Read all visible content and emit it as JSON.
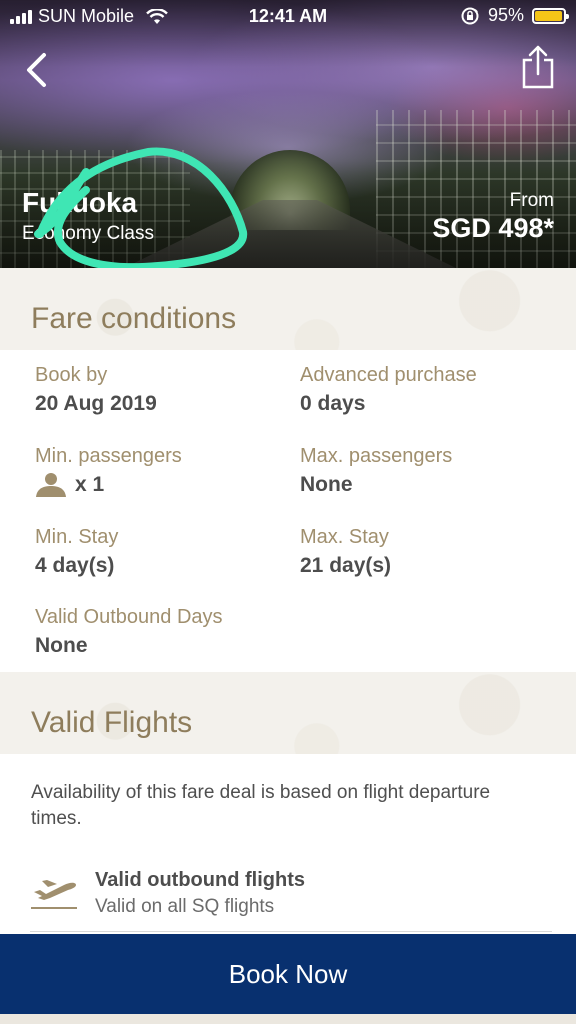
{
  "status_bar": {
    "carrier": "SUN Mobile",
    "time": "12:41 AM",
    "battery": "95%",
    "battery_level": 0.95,
    "battery_color": "#f5c518"
  },
  "header": {
    "back_icon": "chevron-left-icon",
    "share_icon": "share-icon",
    "destination": "Fukuoka",
    "cabin_class": "Economy Class",
    "price_prefix": "From",
    "price": "SGD 498*"
  },
  "fare_conditions": {
    "title": "Fare conditions",
    "items": [
      {
        "label": "Book by",
        "value": "20 Aug 2019"
      },
      {
        "label": "Advanced purchase",
        "value": "0 days"
      },
      {
        "label": "Min. passengers",
        "value": "x 1",
        "icon": "person-icon"
      },
      {
        "label": "Max. passengers",
        "value": "None"
      },
      {
        "label": "Min. Stay",
        "value": "4 day(s)"
      },
      {
        "label": "Max. Stay",
        "value": "21 day(s)"
      },
      {
        "label": "Valid Outbound Days",
        "value": "None"
      }
    ]
  },
  "valid_flights": {
    "title": "Valid Flights",
    "description": "Availability of this fare deal is based on flight departure times.",
    "outbound": {
      "icon": "plane-departure-icon",
      "title": "Valid outbound flights",
      "detail": "Valid on all SQ flights"
    }
  },
  "footer": {
    "book_label": "Book Now",
    "accent_color": "#08306f"
  },
  "colors": {
    "label_gold": "#a08f6e",
    "heading_gold": "#8e7d5c",
    "annotation_teal": "#3fe6b4"
  }
}
